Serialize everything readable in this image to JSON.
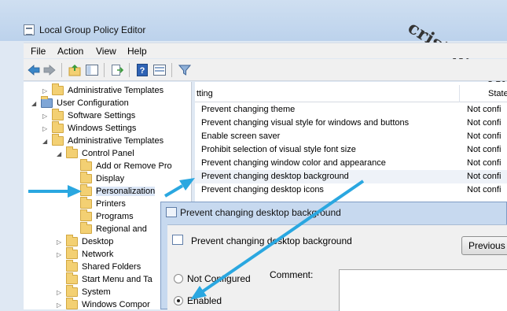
{
  "window": {
    "title": "Local Group Policy Editor"
  },
  "watermark": "cristianls.ro",
  "menu": [
    "File",
    "Action",
    "View",
    "Help"
  ],
  "tree": [
    {
      "label": "Administrative Templates",
      "indent": 1,
      "expander": "▷"
    },
    {
      "label": "User Configuration",
      "indent": 0,
      "expander": "◢"
    },
    {
      "label": "Software Settings",
      "indent": 1,
      "expander": "▷"
    },
    {
      "label": "Windows Settings",
      "indent": 1,
      "expander": "▷"
    },
    {
      "label": "Administrative Templates",
      "indent": 1,
      "expander": "◢"
    },
    {
      "label": "Control Panel",
      "indent": 2,
      "expander": "◢"
    },
    {
      "label": "Add or Remove Pro",
      "indent": 3,
      "expander": ""
    },
    {
      "label": "Display",
      "indent": 3,
      "expander": ""
    },
    {
      "label": "Personalization",
      "indent": 3,
      "expander": "",
      "selected": true
    },
    {
      "label": "Printers",
      "indent": 3,
      "expander": ""
    },
    {
      "label": "Programs",
      "indent": 3,
      "expander": ""
    },
    {
      "label": "Regional and",
      "indent": 3,
      "expander": ""
    },
    {
      "label": "Desktop",
      "indent": 2,
      "expander": "▷"
    },
    {
      "label": "Network",
      "indent": 2,
      "expander": "▷"
    },
    {
      "label": "Shared Folders",
      "indent": 2,
      "expander": ""
    },
    {
      "label": "Start Menu and Ta",
      "indent": 2,
      "expander": ""
    },
    {
      "label": "System",
      "indent": 2,
      "expander": "▷"
    },
    {
      "label": "Windows Compor",
      "indent": 2,
      "expander": "▷"
    }
  ],
  "list": {
    "columns": {
      "setting": "tting",
      "state": "State"
    },
    "rows": [
      {
        "setting": "Prevent changing theme",
        "state": "Not confi"
      },
      {
        "setting": "Prevent changing visual style for windows and buttons",
        "state": "Not confi"
      },
      {
        "setting": "Enable screen saver",
        "state": "Not confi"
      },
      {
        "setting": "Prohibit selection of visual style font size",
        "state": "Not confi"
      },
      {
        "setting": "Prevent changing window color and appearance",
        "state": "Not confi"
      },
      {
        "setting": "Prevent changing desktop background",
        "state": "Not confi",
        "highlight": true
      },
      {
        "setting": "Prevent changing desktop icons",
        "state": "Not confi"
      }
    ]
  },
  "dialog": {
    "title": "Prevent changing desktop background",
    "heading": "Prevent changing desktop background",
    "previous_button": "Previous S",
    "options": [
      {
        "label": "Not Configured",
        "checked": false
      },
      {
        "label": "Enabled",
        "checked": true
      }
    ],
    "comment_label": "Comment:"
  },
  "colors": {
    "arrow": "#2aa7e0",
    "title_bar": "#c4d7ee",
    "selection": "#dbe6f6"
  }
}
